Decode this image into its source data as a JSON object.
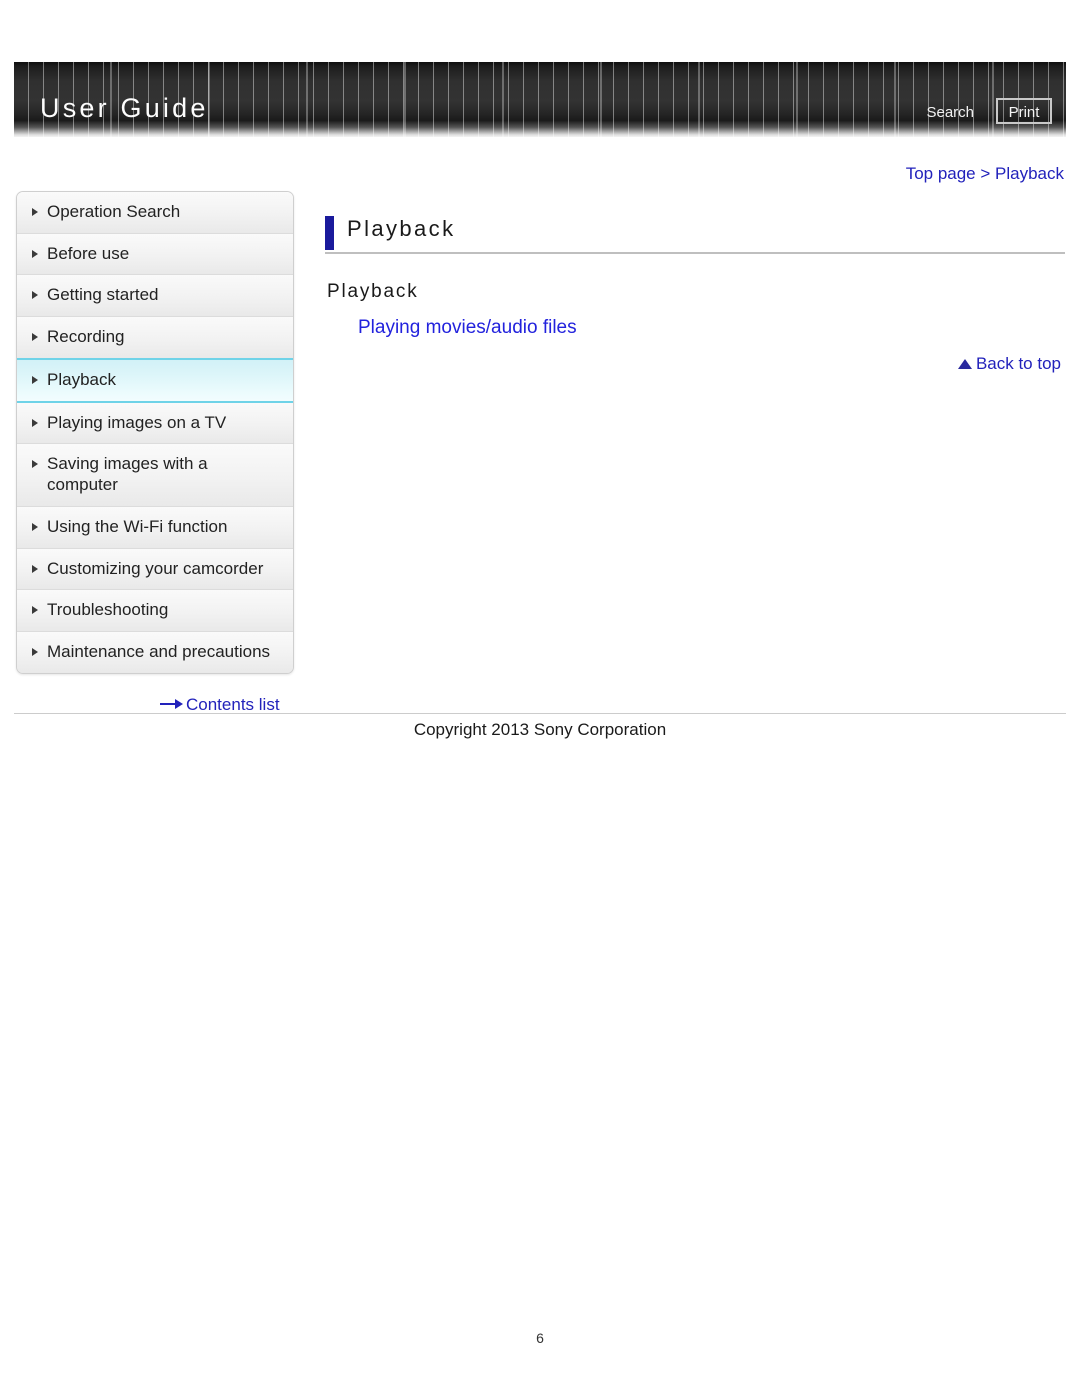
{
  "header": {
    "title": "User Guide",
    "search_label": "Search",
    "print_label": "Print"
  },
  "sidebar": {
    "items": [
      {
        "label": "Operation Search",
        "active": false
      },
      {
        "label": "Before use",
        "active": false
      },
      {
        "label": "Getting started",
        "active": false
      },
      {
        "label": "Recording",
        "active": false
      },
      {
        "label": "Playback",
        "active": true
      },
      {
        "label": "Playing images on a TV",
        "active": false
      },
      {
        "label": "Saving images with a computer",
        "active": false
      },
      {
        "label": "Using the Wi-Fi function",
        "active": false
      },
      {
        "label": "Customizing your camcorder",
        "active": false
      },
      {
        "label": "Troubleshooting",
        "active": false
      },
      {
        "label": "Maintenance and precautions",
        "active": false
      }
    ],
    "contents_list_label": "Contents list"
  },
  "main": {
    "breadcrumb": "Top page > Playback",
    "page_heading": "Playback",
    "sub_heading": "Playback",
    "topic_link": "Playing movies/audio files",
    "back_to_top_label": "Back to top"
  },
  "footer": {
    "copyright": "Copyright 2013 Sony Corporation",
    "page_number": "6"
  },
  "colors": {
    "link_blue": "#2222bb",
    "accent_bar": "#1a1a9c",
    "active_item_border": "#6fd3e8",
    "banner_dark": "#303030"
  }
}
